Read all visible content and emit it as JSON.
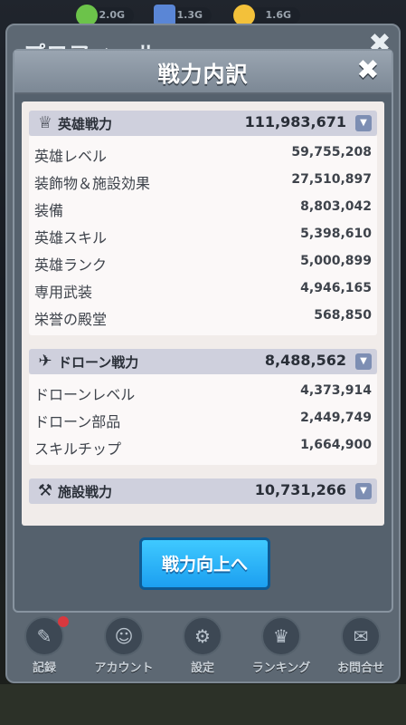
{
  "top_bar": {
    "resources": [
      {
        "value": "2.0G",
        "color": "#6cc34a",
        "icon": "gem-icon"
      },
      {
        "value": "1.3G",
        "color": "#5a86d6",
        "icon": "block-icon"
      },
      {
        "value": "1.6G",
        "color": "#f3c13a",
        "icon": "coin-icon"
      }
    ]
  },
  "profile": {
    "title": "プロフィール",
    "close_icon": "✖"
  },
  "modal": {
    "title": "戦力内訳",
    "close_icon": "✖",
    "sections": [
      {
        "label": "英雄戦力",
        "total": "111,983,671",
        "icon": "hero-crown-icon",
        "rows": [
          {
            "label": "英雄レベル",
            "value": "59,755,208"
          },
          {
            "label": "装飾物＆施設効果",
            "value": "27,510,897"
          },
          {
            "label": "装備",
            "value": "8,803,042"
          },
          {
            "label": "英雄スキル",
            "value": "5,398,610"
          },
          {
            "label": "英雄ランク",
            "value": "5,000,899"
          },
          {
            "label": "専用武装",
            "value": "4,946,165"
          },
          {
            "label": "栄誉の殿堂",
            "value": "568,850"
          }
        ]
      },
      {
        "label": "ドローン戦力",
        "total": "8,488,562",
        "icon": "drone-icon",
        "rows": [
          {
            "label": "ドローンレベル",
            "value": "4,373,914"
          },
          {
            "label": "ドローン部品",
            "value": "2,449,749"
          },
          {
            "label": "スキルチップ",
            "value": "1,664,900"
          }
        ]
      },
      {
        "label": "施設戦力",
        "total": "10,731,266",
        "icon": "facility-icon",
        "rows": []
      }
    ],
    "cta_label": "戦力向上へ"
  },
  "bottom_menu": [
    {
      "label": "記録",
      "icon": "record-icon",
      "badge": true
    },
    {
      "label": "アカウント",
      "icon": "account-icon",
      "badge": false
    },
    {
      "label": "設定",
      "icon": "settings-gear-icon",
      "badge": false
    },
    {
      "label": "ランキング",
      "icon": "trophy-icon",
      "badge": false
    },
    {
      "label": "お問合せ",
      "icon": "support-icon",
      "badge": false
    }
  ]
}
